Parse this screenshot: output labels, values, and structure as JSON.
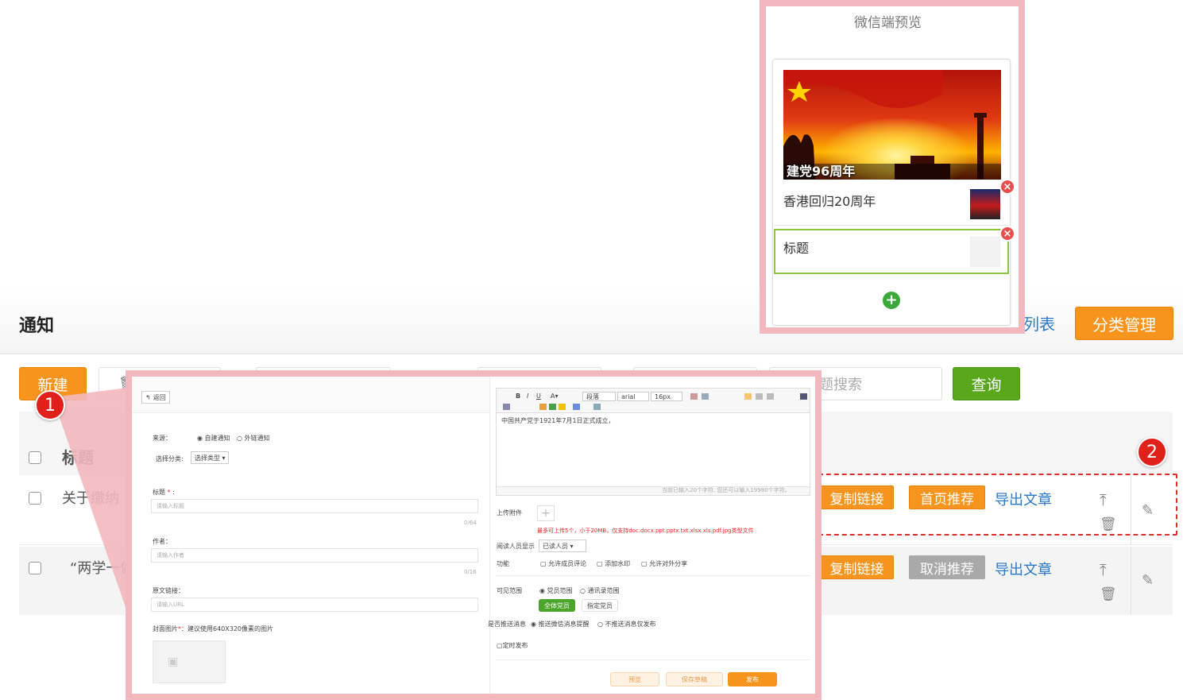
{
  "header": {
    "title": "通知",
    "list_link": "列表",
    "category_btn": "分类管理"
  },
  "toolbar": {
    "new_btn": "新建",
    "search_placeholder": "题搜索",
    "query_btn": "查询"
  },
  "table": {
    "col_title": "标题",
    "rows": [
      {
        "title": "关于缴纳",
        "copy_btn": "复制链接",
        "recommend_btn": "首页推荐",
        "export_link": "导出文章"
      },
      {
        "title": "“两学一做",
        "copy_btn": "复制链接",
        "recommend_btn": "取消推荐",
        "export_link": "导出文章"
      }
    ]
  },
  "markers": {
    "one": "1",
    "two": "2"
  },
  "preview": {
    "title": "微信端预览",
    "banner_caption": "建党96周年",
    "items": [
      "香港回归20周年",
      "标题"
    ]
  },
  "form": {
    "back": "返回",
    "source_label": "来源：",
    "source_opt1": "自建通知",
    "source_opt2": "外链通知",
    "category_label": "选择分类:",
    "category_select": "选择类型",
    "title_label": "标题",
    "title_placeholder": "请输入标题",
    "title_count": "0/64",
    "author_label": "作者：",
    "author_placeholder": "请输入作者",
    "author_count": "0/16",
    "link_label": "原文链接：",
    "link_placeholder": "请输入URL",
    "cover_label": "封面图片",
    "cover_hint": "：建议使用640X320像素的图片",
    "editor_para": "段落",
    "editor_font": "arial",
    "editor_size": "16px",
    "editor_content": "中国共产党于1921年7月1日正式成立，",
    "editor_counter": "当前已输入20个字符, 您还可以输入19980个字符。",
    "attach_label": "上传附件",
    "attach_hint": "最多可上传5个，小于20MB，仅支持doc.docx.ppt.pptx.txt.xlsx.xls.pdf.jpg类型文件",
    "readers_label": "阅读人员显示",
    "readers_select": "已读人员",
    "feature_label": "功能",
    "feature_opts": [
      "允许成员评论",
      "添加水印",
      "允许对外分享"
    ],
    "visible_label": "可见范围",
    "visible_opt1": "党员范围",
    "visible_opt2": "通讯录范围",
    "all_members_btn": "全体党员",
    "assign_members_btn": "指定党员",
    "push_label": "是否推送消息",
    "push_opt1": "推送微信消息提醒",
    "push_opt2": "不推送消息仅发布",
    "schedule_label": "定时发布",
    "preview_btn": "预览",
    "draft_btn": "保存草稿",
    "publish_btn": "发布"
  }
}
